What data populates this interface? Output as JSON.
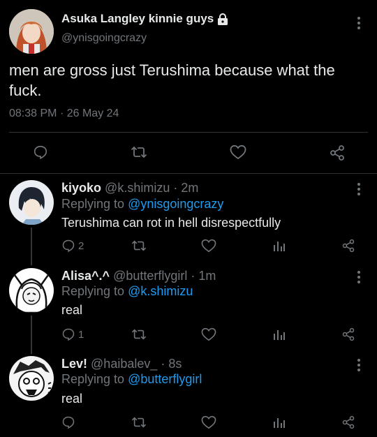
{
  "main_tweet": {
    "display_name": "Asuka Langley kinnie guys",
    "handle": "@ynisgoingcrazy",
    "text": "men are gross just Terushima because what the fuck.",
    "time": "08:38 PM",
    "date": "26 May 24",
    "separator": "·"
  },
  "replies": [
    {
      "display_name": "kiyoko",
      "handle": "@k.shimizu",
      "time": "2m",
      "replying_prefix": "Replying to",
      "replying_to": "@ynisgoingcrazy",
      "text": "Terushima can rot in hell disrespectfully",
      "reply_count": "2"
    },
    {
      "display_name": "Alisa^.^",
      "handle": "@butterflygirl",
      "time": "1m",
      "replying_prefix": "Replying to",
      "replying_to": "@k.shimizu",
      "text": "real",
      "reply_count": "1"
    },
    {
      "display_name": "Lev!",
      "handle": "@haibalev_",
      "time": "8s",
      "replying_prefix": "Replying to",
      "replying_to": "@butterflygirl",
      "text": "real",
      "reply_count": ""
    }
  ],
  "colors": {
    "background": "#000000",
    "text": "#e7e9ea",
    "muted": "#71767b",
    "accent": "#1d9bf0",
    "divider": "#2f3336"
  },
  "icons": [
    "lock-icon",
    "more-icon",
    "reply-icon",
    "retweet-icon",
    "like-icon",
    "share-icon",
    "views-icon"
  ]
}
